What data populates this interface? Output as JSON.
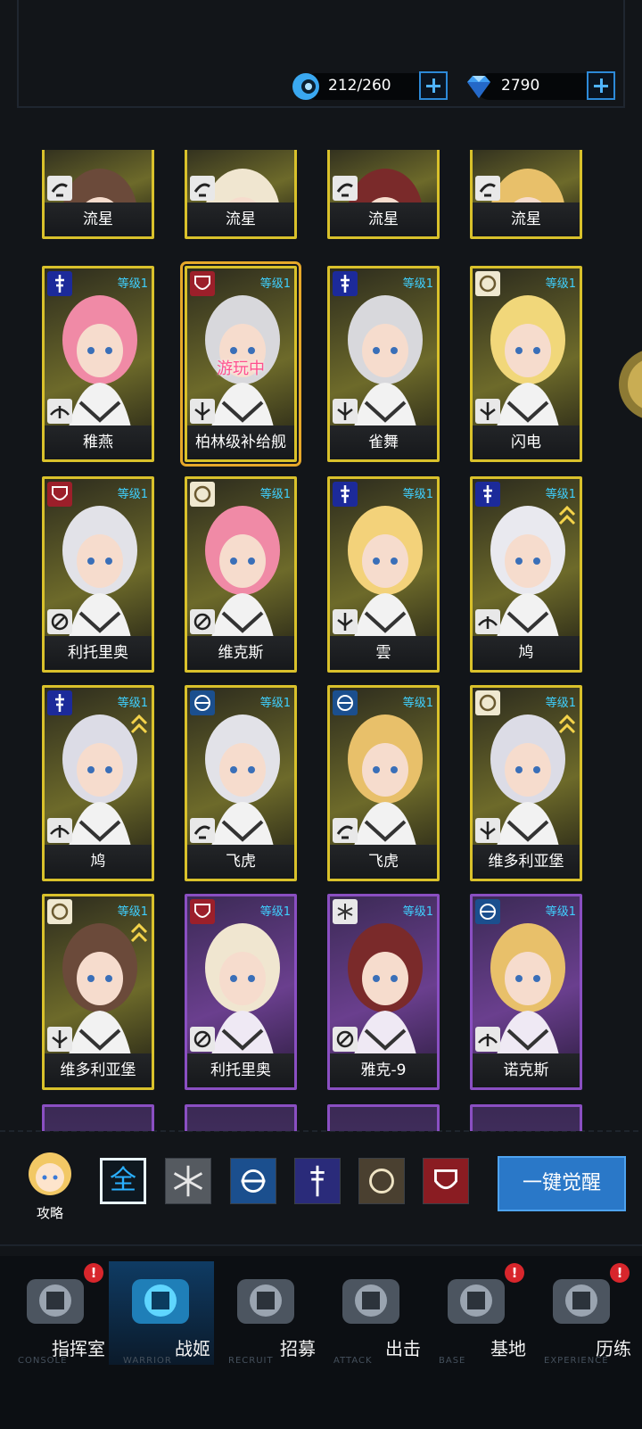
{
  "resources": {
    "stamina": {
      "value": "212/260",
      "icon": "stamina-icon"
    },
    "gems": {
      "value": "2790",
      "icon": "diamond-icon"
    }
  },
  "level_label": "等级1",
  "status_playing": "游玩中",
  "cards": [
    {
      "name": "流星",
      "rarity": "gold",
      "class": "destroyer",
      "role": "speed",
      "level_shown": false
    },
    {
      "name": "流星",
      "rarity": "gold",
      "class": "destroyer",
      "role": "speed",
      "level_shown": false
    },
    {
      "name": "流星",
      "rarity": "gold",
      "class": "destroyer",
      "role": "speed",
      "level_shown": false
    },
    {
      "name": "流星",
      "rarity": "gold",
      "class": "destroyer",
      "role": "speed",
      "level_shown": false
    },
    {
      "name": "稚燕",
      "rarity": "gold",
      "class": "sword",
      "role": "wing",
      "level_shown": true
    },
    {
      "name": "柏林级补给舰",
      "rarity": "gold",
      "class": "shield",
      "role": "support",
      "level_shown": true,
      "status": "游玩中"
    },
    {
      "name": "雀舞",
      "rarity": "gold",
      "class": "sword",
      "role": "support",
      "level_shown": true
    },
    {
      "name": "闪电",
      "rarity": "gold",
      "class": "lion",
      "role": "support",
      "level_shown": true
    },
    {
      "name": "利托里奥",
      "rarity": "gold",
      "class": "shield",
      "role": "gun",
      "level_shown": true
    },
    {
      "name": "维克斯",
      "rarity": "gold",
      "class": "lion",
      "role": "gun",
      "level_shown": true
    },
    {
      "name": "雲",
      "rarity": "gold",
      "class": "sword",
      "role": "support",
      "level_shown": true
    },
    {
      "name": "鸠",
      "rarity": "gold",
      "class": "sword",
      "role": "wing",
      "level_shown": true,
      "chevron": true
    },
    {
      "name": "鸠",
      "rarity": "gold",
      "class": "sword",
      "role": "wing",
      "level_shown": true,
      "chevron": true
    },
    {
      "name": "飞虎",
      "rarity": "gold",
      "class": "emblem",
      "role": "speed",
      "level_shown": true
    },
    {
      "name": "飞虎",
      "rarity": "gold",
      "class": "emblem",
      "role": "speed",
      "level_shown": true
    },
    {
      "name": "维多利亚堡",
      "rarity": "gold",
      "class": "lion",
      "role": "support",
      "level_shown": true,
      "chevron": true
    },
    {
      "name": "维多利亚堡",
      "rarity": "gold",
      "class": "lion",
      "role": "support",
      "level_shown": true,
      "chevron": true
    },
    {
      "name": "利托里奥",
      "rarity": "purple",
      "class": "shield",
      "role": "gun",
      "level_shown": true
    },
    {
      "name": "雅克-9",
      "rarity": "purple",
      "class": "snow",
      "role": "gun",
      "level_shown": true
    },
    {
      "name": "诺克斯",
      "rarity": "purple",
      "class": "emblem",
      "role": "wing",
      "level_shown": true
    }
  ],
  "filters": [
    {
      "label": "全",
      "icon": "all-filter-icon",
      "active": true
    },
    {
      "label": "",
      "icon": "snowflake-filter-icon",
      "active": false
    },
    {
      "label": "",
      "icon": "emblem-filter-icon",
      "active": false
    },
    {
      "label": "",
      "icon": "sword-filter-icon",
      "active": false
    },
    {
      "label": "",
      "icon": "lion-filter-icon",
      "active": false
    },
    {
      "label": "",
      "icon": "shield-filter-icon",
      "active": false
    }
  ],
  "guide_label": "攻略",
  "awaken_label": "一键觉醒",
  "nav": [
    {
      "label": "指挥室",
      "en": "CONSOLE",
      "badge": "!",
      "active": false
    },
    {
      "label": "战姬",
      "en": "WARRIOR",
      "badge": "",
      "active": true
    },
    {
      "label": "招募",
      "en": "RECRUIT",
      "badge": "",
      "active": false
    },
    {
      "label": "出击",
      "en": "ATTACK",
      "badge": "",
      "active": false
    },
    {
      "label": "基地",
      "en": "BASE",
      "badge": "!",
      "active": false
    },
    {
      "label": "历练",
      "en": "EXPERIENCE",
      "badge": "!",
      "active": false
    }
  ]
}
